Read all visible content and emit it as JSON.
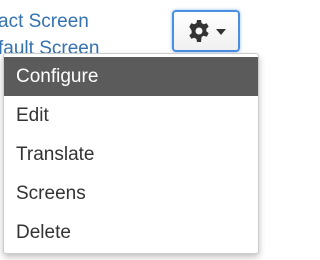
{
  "background_links": [
    "act Screen",
    "fault Screen"
  ],
  "gear_button": {
    "icon": "gear-icon",
    "caret": "chevron-down-icon"
  },
  "menu": {
    "items": [
      {
        "label": "Configure",
        "active": true
      },
      {
        "label": "Edit",
        "active": false
      },
      {
        "label": "Translate",
        "active": false
      },
      {
        "label": "Screens",
        "active": false
      },
      {
        "label": "Delete",
        "active": false
      }
    ]
  },
  "colors": {
    "link": "#3572b0",
    "focus_border": "#4a90e2",
    "active_bg": "#5b5b5b",
    "text": "#333333"
  }
}
